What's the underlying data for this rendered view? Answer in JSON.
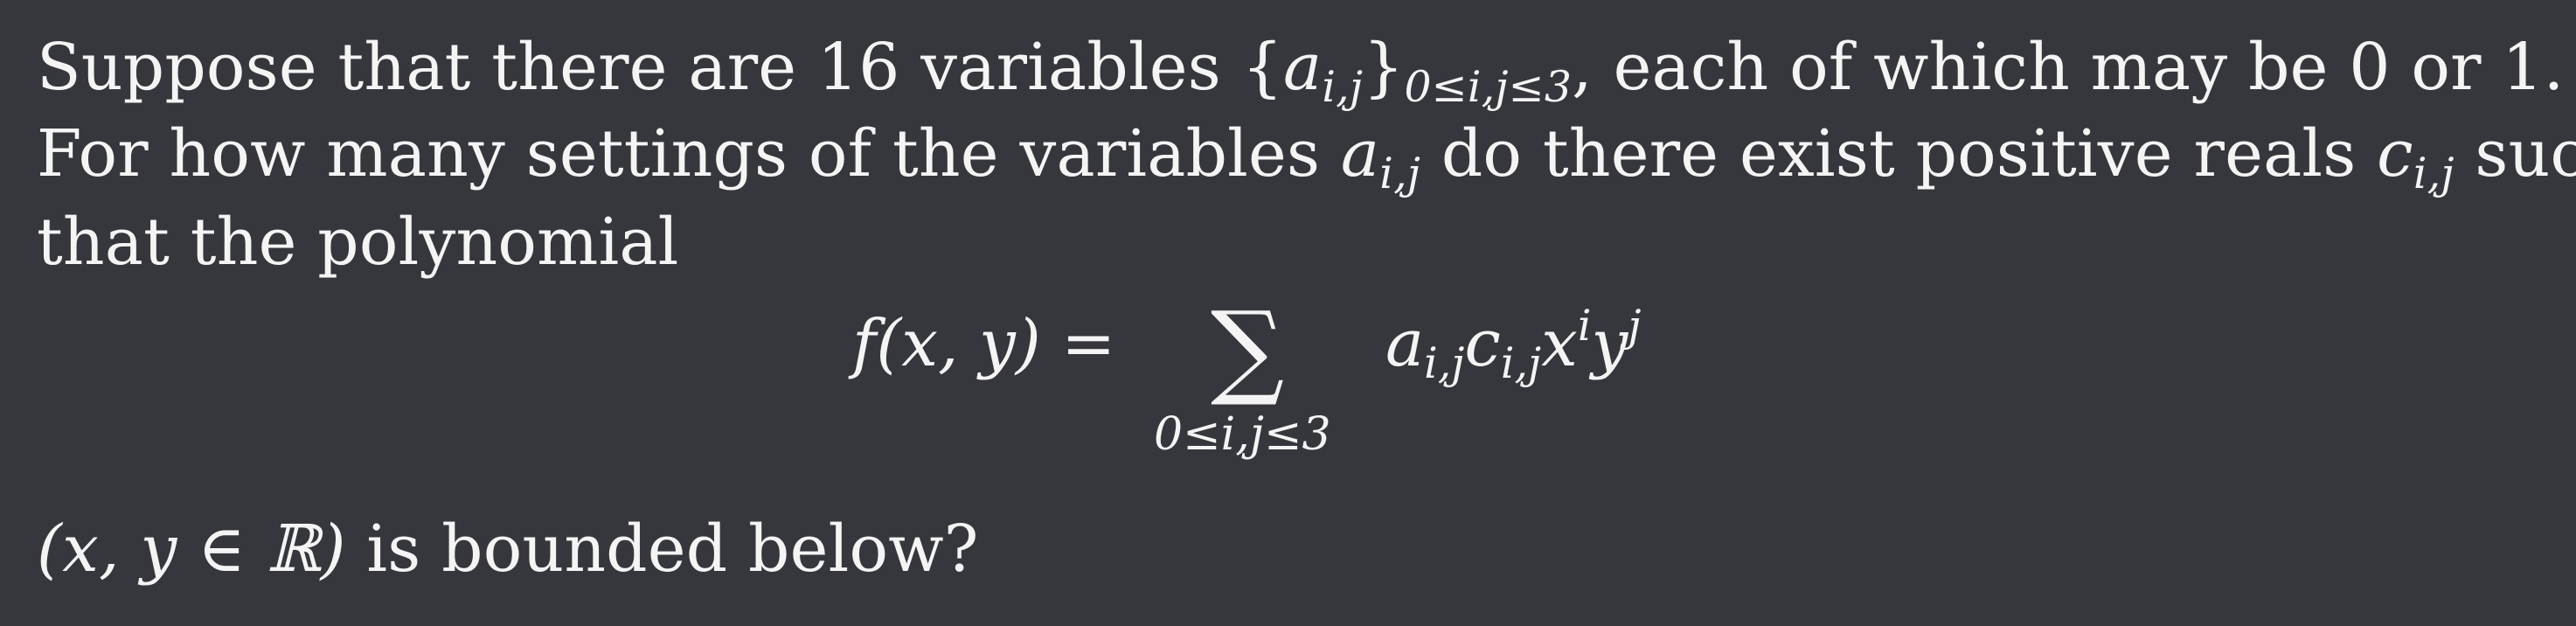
{
  "problem": {
    "sentence1": {
      "before": "Suppose that there are 16 variables ",
      "set_open": "{",
      "set_var": "a",
      "set_var_sub": "i,j",
      "set_close": "}",
      "set_range": "0≤i,j≤3",
      "after": ", each of which may be 0 or 1."
    },
    "sentence2": {
      "before": "For how many settings of the variables ",
      "var_a": "a",
      "var_a_sub": "i,j",
      "middle": " do there exist positive reals ",
      "var_c": "c",
      "var_c_sub": "i,j",
      "after": " such"
    },
    "sentence3": "that the polynomial",
    "formula": {
      "lhs": "f(x, y) =",
      "sum_symbol": "∑",
      "sum_limits": "0≤i,j≤3",
      "a": "a",
      "a_sub": "i,j",
      "c": "c",
      "c_sub": "i,j",
      "x": "x",
      "x_sup": "i",
      "y": "y",
      "y_sup": "j"
    },
    "final": {
      "domain": "(x, y ∈ ℝ)",
      "question": " is bounded below?"
    }
  }
}
